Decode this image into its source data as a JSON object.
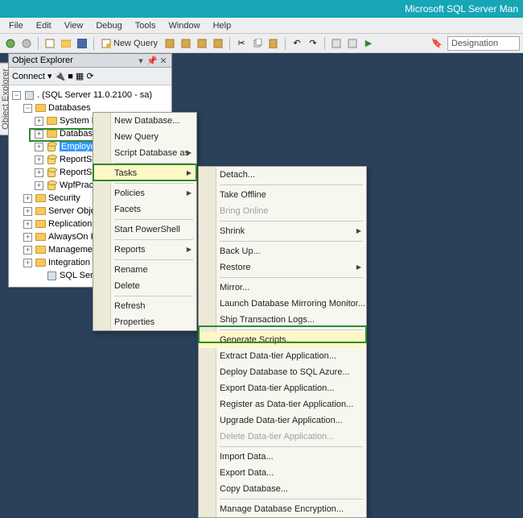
{
  "titlebar": {
    "app_title": "Microsoft SQL Server Man"
  },
  "menubar": {
    "items": [
      "File",
      "Edit",
      "View",
      "Debug",
      "Tools",
      "Window",
      "Help"
    ]
  },
  "toolbar": {
    "new_query": "New Query",
    "combo_value": "Designation"
  },
  "object_explorer": {
    "title": "Object Explorer",
    "connect_label": "Connect ▾",
    "root": ". (SQL Server 11.0.2100 - sa)",
    "databases_label": "Databases",
    "nodes": {
      "sysdb": "System Databases",
      "snap": "Database Snapshots",
      "employee": "Employee",
      "reportse1": "ReportSe",
      "reportse2": "ReportSer",
      "wpf": "WpfPract",
      "security": "Security",
      "serverobj": "Server Object",
      "replication": "Replication",
      "alwayson": "AlwaysOn Hi",
      "mgmt": "Management",
      "integ": "Integration S",
      "agent": "SQL Server A"
    }
  },
  "ctx1": {
    "new_db": "New Database...",
    "new_query": "New Query",
    "script_db": "Script Database as",
    "tasks": "Tasks",
    "policies": "Policies",
    "facets": "Facets",
    "powershell": "Start PowerShell",
    "reports": "Reports",
    "rename": "Rename",
    "delete": "Delete",
    "refresh": "Refresh",
    "properties": "Properties"
  },
  "ctx2": {
    "detach": "Detach...",
    "take_offline": "Take Offline",
    "bring_online": "Bring Online",
    "shrink": "Shrink",
    "backup": "Back Up...",
    "restore": "Restore",
    "mirror": "Mirror...",
    "launch_mirror": "Launch Database Mirroring Monitor...",
    "ship_logs": "Ship Transaction Logs...",
    "gen_scripts": "Generate Scripts...",
    "extract_dt": "Extract Data-tier Application...",
    "deploy_azure": "Deploy Database to SQL Azure...",
    "export_dt": "Export Data-tier Application...",
    "register_dt": "Register as Data-tier Application...",
    "upgrade_dt": "Upgrade Data-tier Application...",
    "delete_dt": "Delete Data-tier Application...",
    "import_data": "Import Data...",
    "export_data": "Export Data...",
    "copy_db": "Copy Database...",
    "manage_enc": "Manage Database Encryption..."
  },
  "sidebar_tab": "Object Explorer"
}
